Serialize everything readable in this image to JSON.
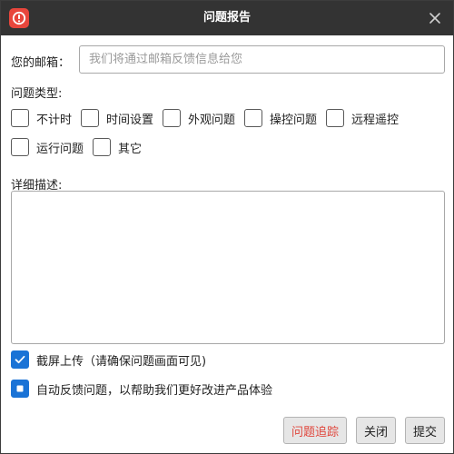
{
  "window": {
    "title": "问题报告",
    "app_icon": "alert-circle-icon",
    "accent_color": "#1a73d6",
    "icon_color": "#e8463c"
  },
  "email": {
    "label": "您的邮箱：",
    "value": "",
    "placeholder": "我们将通过邮箱反馈信息给您"
  },
  "problem_type": {
    "label": "问题类型:",
    "options": [
      {
        "label": "不计时",
        "checked": false
      },
      {
        "label": "时间设置",
        "checked": false
      },
      {
        "label": "外观问题",
        "checked": false
      },
      {
        "label": "操控问题",
        "checked": false
      },
      {
        "label": "远程遥控",
        "checked": false
      },
      {
        "label": "运行问题",
        "checked": false
      },
      {
        "label": "其它",
        "checked": false
      }
    ]
  },
  "description": {
    "label": "详细描述:",
    "value": ""
  },
  "options": {
    "screenshot": {
      "label": "截屏上传（请确保问题画面可见)",
      "checked": true
    },
    "auto_feedback": {
      "label": "自动反馈问题，以帮助我们更好改进产品体验",
      "checked": "partial"
    }
  },
  "buttons": {
    "trace": "问题追踪",
    "close": "关闭",
    "submit": "提交"
  }
}
